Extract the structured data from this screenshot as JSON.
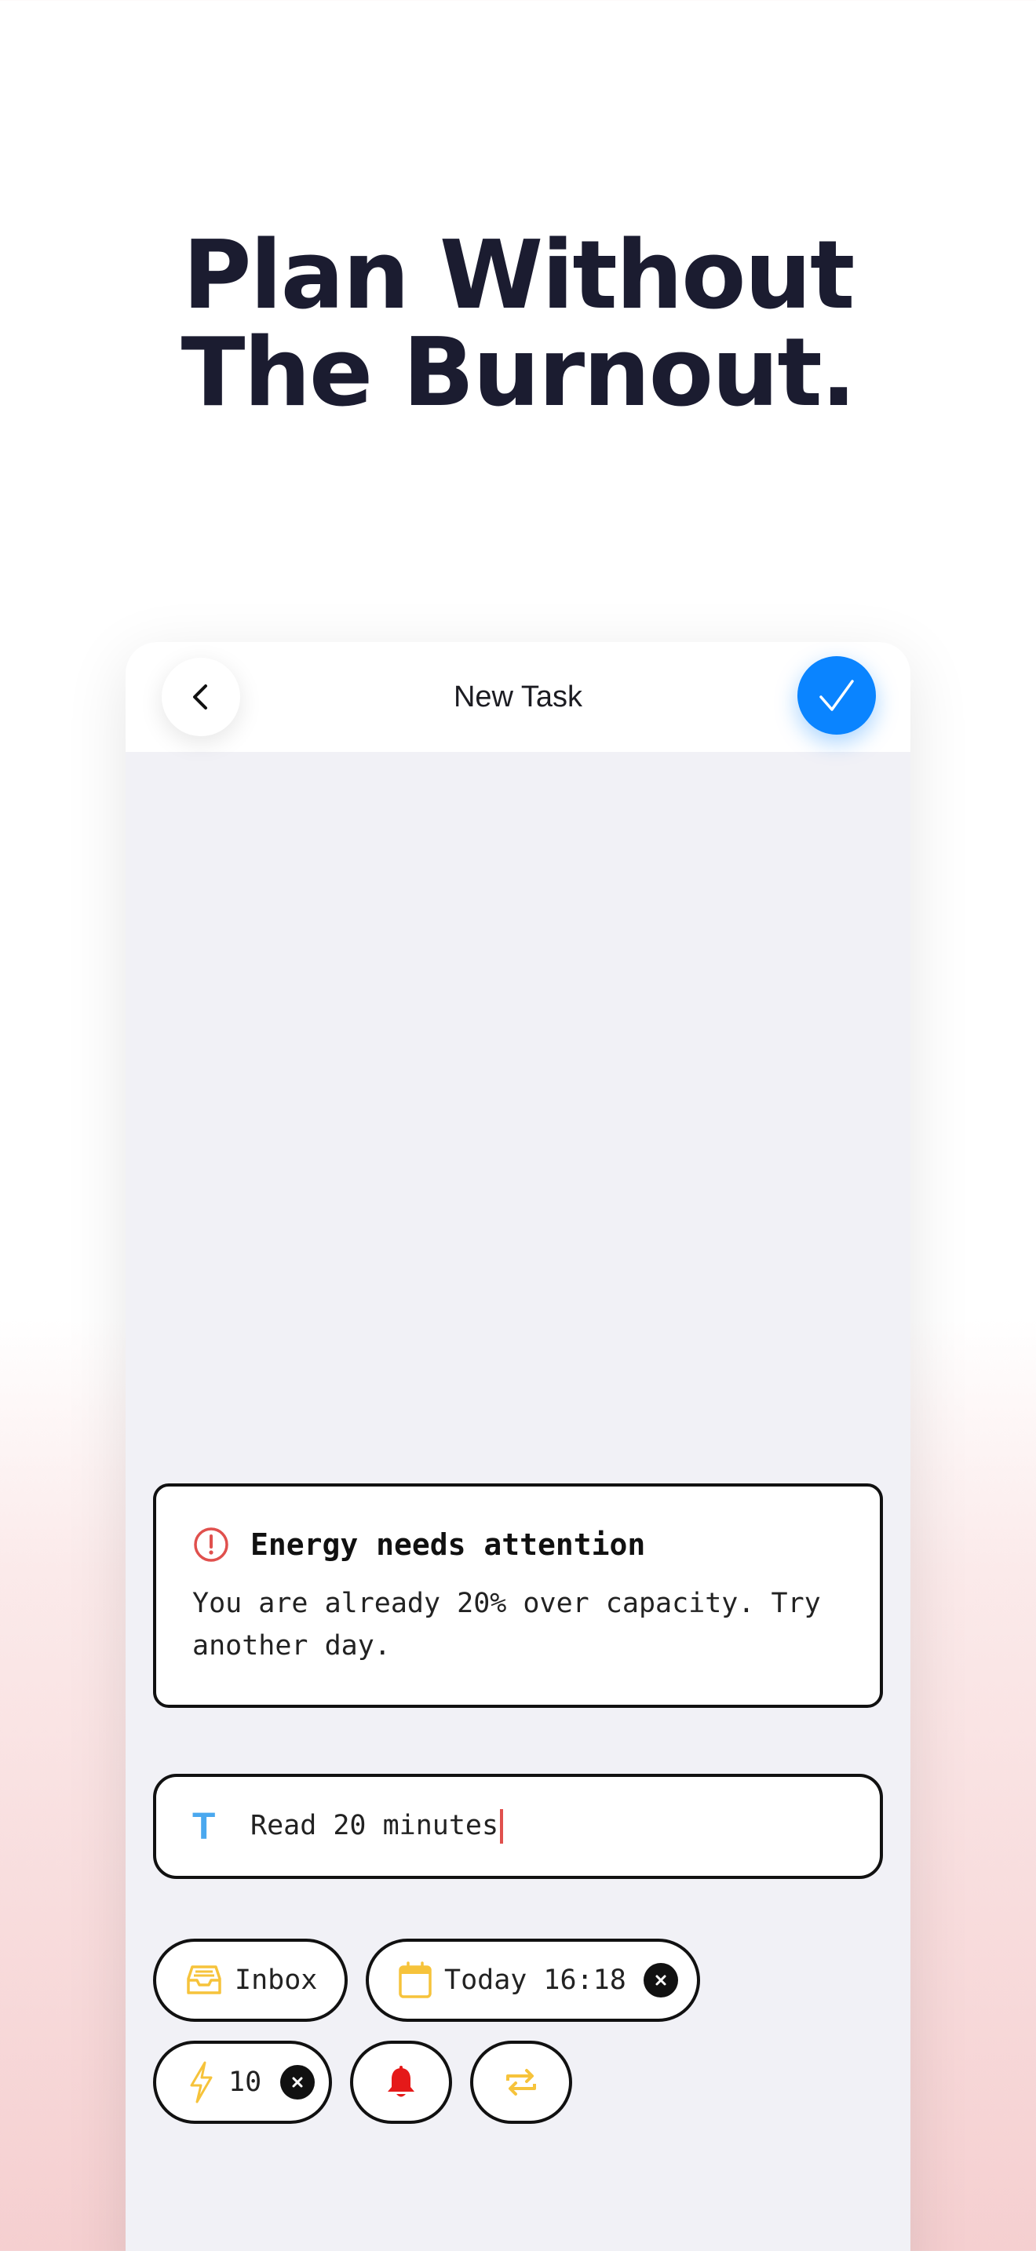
{
  "headline": {
    "line1": "Plan Without",
    "line2": "The Burnout."
  },
  "nav": {
    "title": "New Task",
    "back_icon": "chevron-left-icon",
    "confirm_icon": "checkmark-icon"
  },
  "warning": {
    "title": "Energy needs attention",
    "body": "You are already 20% over capacity. Try another day.",
    "icon": "alert-circle-icon"
  },
  "task": {
    "value": "Read 20 minutes",
    "icon": "text-icon"
  },
  "chips": {
    "list": {
      "label": "Inbox",
      "icon": "inbox-tray-icon"
    },
    "date": {
      "label": "Today 16:18",
      "icon": "calendar-icon"
    },
    "energy": {
      "label": "10",
      "icon": "lightning-icon"
    },
    "reminder": {
      "icon": "bell-icon"
    },
    "repeat": {
      "icon": "repeat-icon"
    }
  },
  "colors": {
    "accent_blue": "#0a84ff",
    "warning_red": "#e0504d",
    "chip_yellow": "#f6c33b",
    "bell_red": "#e51919",
    "text_icon_blue": "#4aa8ef",
    "headline": "#1b1c30"
  }
}
